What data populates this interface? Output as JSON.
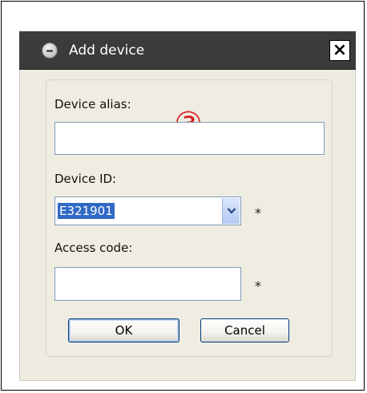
{
  "window": {
    "title": "Add device",
    "close_label": "×"
  },
  "annotation": {
    "marker": "③",
    "color": "#d81c1c"
  },
  "form": {
    "alias": {
      "label": "Device alias:",
      "value": ""
    },
    "device_id": {
      "label": "Device ID:",
      "value": "E321901",
      "required_mark": "*"
    },
    "access_code": {
      "label": "Access code:",
      "value": "",
      "required_mark": "*"
    }
  },
  "buttons": {
    "ok": "OK",
    "cancel": "Cancel"
  },
  "icons": {
    "app": "app-icon",
    "dropdown": "chevron-down-icon",
    "close": "close-icon"
  },
  "colors": {
    "titlebar": "#3b3b3b",
    "dialog_background": "#eeebe1",
    "selection": "#316ac5",
    "input_border": "#7f9db9"
  }
}
